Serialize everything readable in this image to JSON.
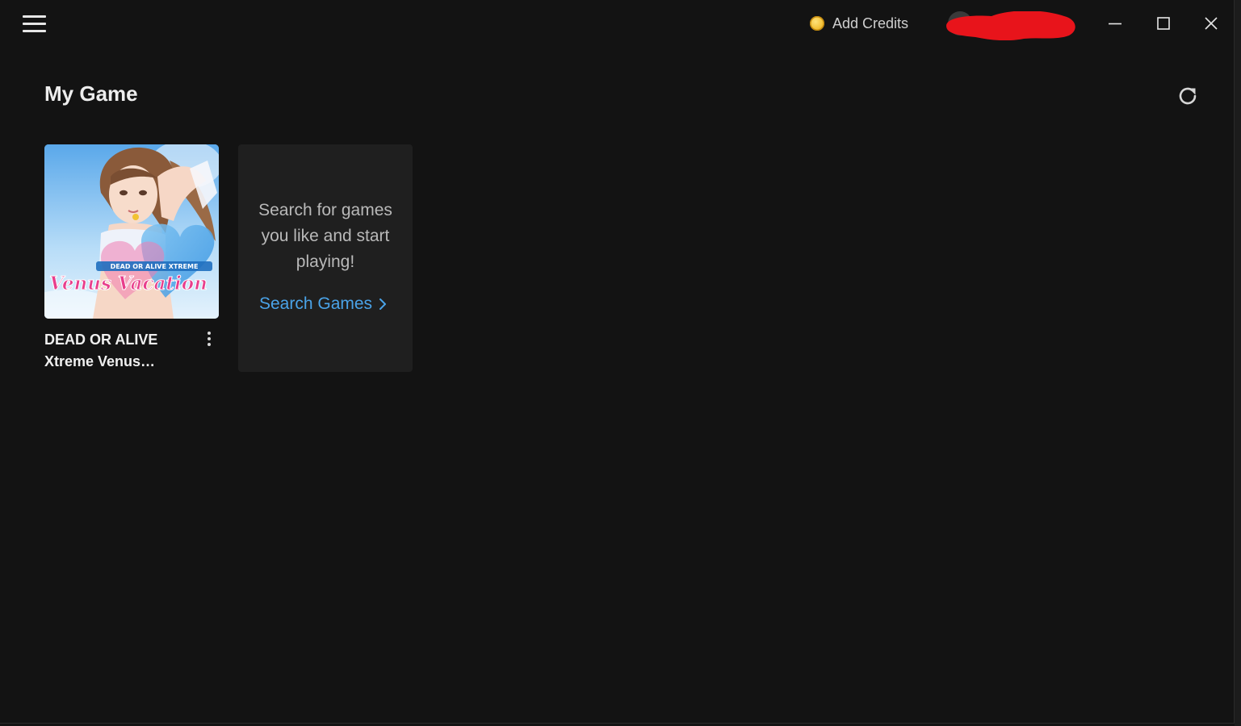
{
  "titlebar": {
    "credits_label": "Add Credits",
    "coin_icon": "coin-icon",
    "window_controls": [
      "minimize-icon",
      "maximize-icon",
      "close-icon"
    ]
  },
  "page": {
    "title": "My Game"
  },
  "games": [
    {
      "title_line1": "DEAD OR ALIVE",
      "title_line2": "Xtreme Venus…",
      "cover_logo_small": "DEAD OR ALIVE XTREME",
      "cover_logo_script": "Venus Vacation"
    }
  ],
  "search_card": {
    "line1": "Search for games",
    "line2": "you like and start",
    "line3": "playing!",
    "link_label": "Search Games"
  },
  "colors": {
    "background": "#131313",
    "card": "#1f1f1f",
    "link": "#4aa3e8",
    "redaction": "#e8141b"
  }
}
